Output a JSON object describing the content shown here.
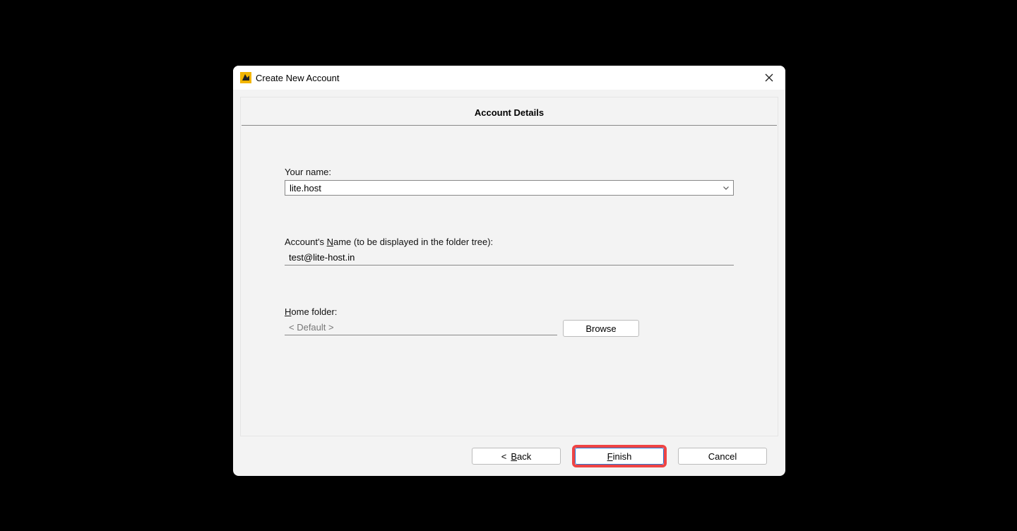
{
  "dialog": {
    "title": "Create New Account",
    "section_title": "Account Details",
    "close_label": "Close"
  },
  "fields": {
    "your_name_label": "Your name:",
    "your_name_value": "lite.host",
    "account_name_label_pre": "Account's ",
    "account_name_label_u": "N",
    "account_name_label_post": "ame (to be displayed in the folder tree):",
    "account_name_value": "test@lite-host.in",
    "home_label_u": "H",
    "home_label_rest": "ome folder:",
    "home_value": "< Default >",
    "browse_label": "Browse"
  },
  "footer": {
    "back_pre": "<   ",
    "back_u": "B",
    "back_post": "ack",
    "finish_u": "F",
    "finish_post": "inish",
    "cancel_label": "Cancel"
  }
}
